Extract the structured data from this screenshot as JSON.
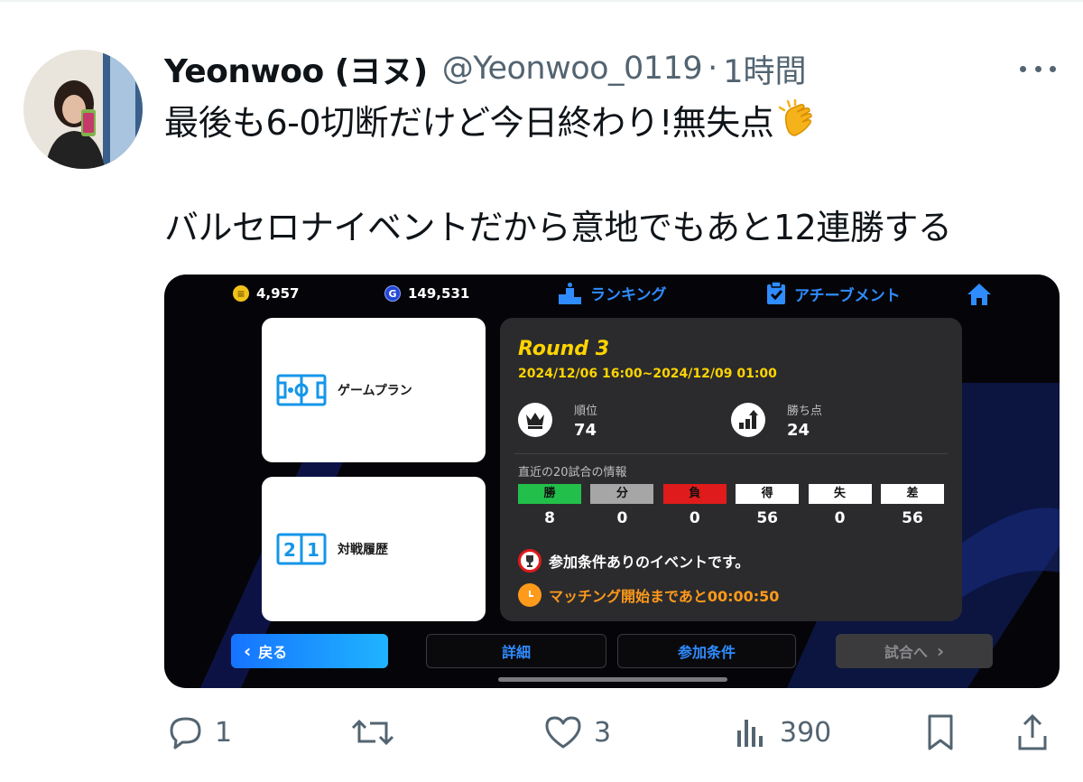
{
  "tweet": {
    "author_name": "Yeonwoo (ヨヌ)",
    "handle": "@Yeonwoo_0119",
    "separator": "·",
    "time": "1時間",
    "text_line1": "最後も6-0切断だけど今日終わり!無失点",
    "text_line2": "バルセロナイベントだから意地でもあと12連勝する"
  },
  "game": {
    "coins": "4,957",
    "gems": "149,531",
    "nav_ranking": "ランキング",
    "nav_achievement": "アチーブメント",
    "menu_gameplan": "ゲームプラン",
    "menu_history": "対戦履歴",
    "round_title": "Round 3",
    "round_period": "2024/12/06 16:00~2024/12/09 01:00",
    "rank_label": "順位",
    "rank_value": "74",
    "points_label": "勝ち点",
    "points_value": "24",
    "recent_title": "直近の20試合の情報",
    "results": [
      {
        "label": "勝",
        "value": "8",
        "color": "#22c04a"
      },
      {
        "label": "分",
        "value": "0",
        "color": "#a6a6a6"
      },
      {
        "label": "負",
        "value": "0",
        "color": "#e01b1b"
      },
      {
        "label": "得",
        "value": "56",
        "color": "#ffffff"
      },
      {
        "label": "失",
        "value": "0",
        "color": "#ffffff"
      },
      {
        "label": "差",
        "value": "56",
        "color": "#ffffff"
      }
    ],
    "notice_condition": "参加条件ありのイベントです。",
    "notice_matching": "マッチング開始まであと00:00:50",
    "btn_back": "戻る",
    "btn_detail": "詳細",
    "btn_conditions": "参加条件",
    "btn_match": "試合へ"
  },
  "actions": {
    "replies": "1",
    "likes": "3",
    "views": "390"
  },
  "colors": {
    "accent_blue": "#2f8cff",
    "round_yellow": "#ffd400",
    "text_gray": "#536471"
  }
}
